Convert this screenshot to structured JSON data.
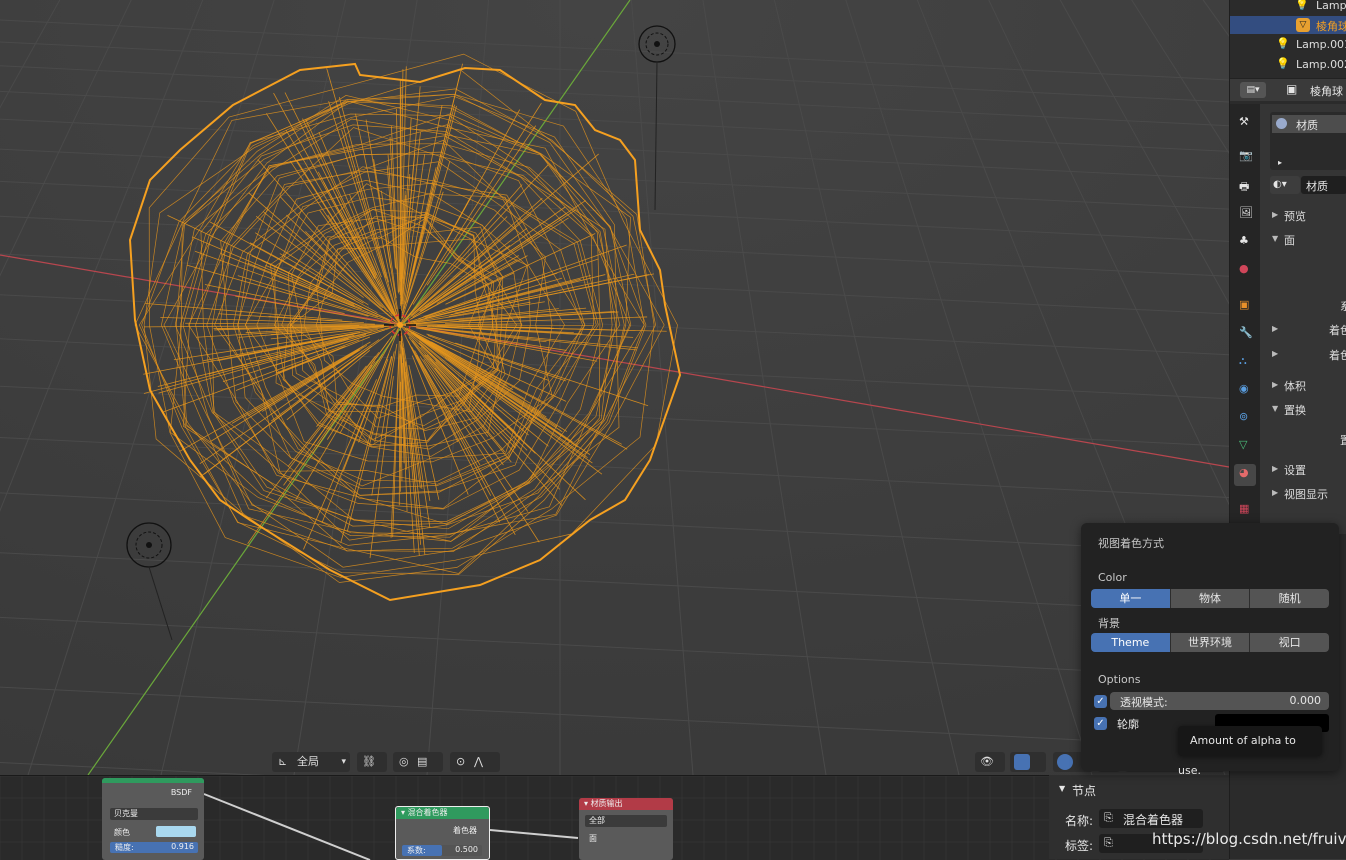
{
  "outliner": {
    "items": [
      {
        "label": "Lamp",
        "icon": "lamp-icon"
      },
      {
        "label": "棱角球",
        "icon": "mesh-icon",
        "selected": true
      },
      {
        "label": "Lamp.001",
        "icon": "lamp-icon"
      },
      {
        "label": "Lamp.002",
        "icon": "lamp-icon"
      }
    ]
  },
  "properties": {
    "object_name": "棱角球",
    "material_slot": "材质",
    "material_name": "材质",
    "sections": {
      "preview": "预览",
      "surface": "面",
      "sys_partial": "系",
      "shader1_partial": "着色",
      "shader2_partial": "着色",
      "volume": "体积",
      "displacement": "置换",
      "disp_partial": "置",
      "settings": "设置",
      "viewport_display": "视图显示"
    }
  },
  "popover": {
    "title": "视图着色方式",
    "color_label": "Color",
    "color_options": [
      "单一",
      "物体",
      "随机"
    ],
    "color_selected": 0,
    "background_label": "背景",
    "background_options": [
      "Theme",
      "世界环境",
      "视口"
    ],
    "background_selected": 0,
    "options_label": "Options",
    "xray_label": "透视模式:",
    "xray_value": "0.000",
    "xray_checked": true,
    "outline_label": "轮廓",
    "outline_checked": true
  },
  "tooltip": {
    "text": "Amount of alpha to use."
  },
  "viewport_header": {
    "transform_orientation": "全局"
  },
  "node_editor": {
    "nodes": {
      "bsdf": {
        "title": "BSDF",
        "dropdown": "贝克曼",
        "color_label": "颜色",
        "roughness_label": "糙度:",
        "roughness_value": "0.916"
      },
      "mix": {
        "title": "混合着色器",
        "output": "着色器",
        "factor_label": "系数:",
        "factor_value": "0.500"
      },
      "output": {
        "title": "材质输出",
        "target": "全部",
        "surface": "面"
      }
    },
    "side_panel": {
      "section": "节点",
      "name_label": "名称:",
      "name_value": "混合着色器",
      "label_label": "标签:"
    }
  },
  "watermark": "https://blog.csdn.net/fruiva",
  "colors": {
    "accent": "#4772b3",
    "selection_orange": "#f5a020",
    "x_axis": "#c8464f",
    "y_axis": "#6ea83a"
  }
}
